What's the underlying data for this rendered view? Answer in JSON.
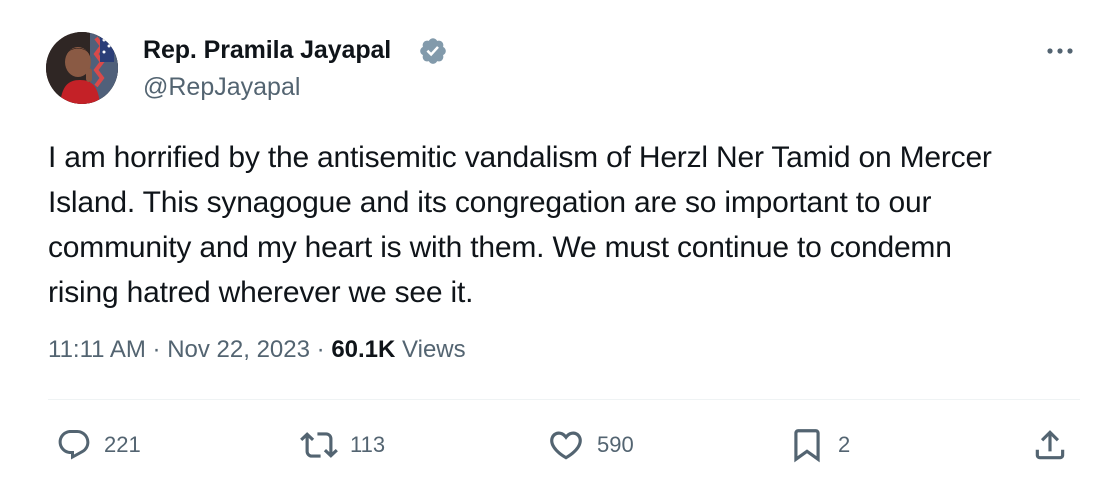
{
  "author": {
    "name": "Rep. Pramila Jayapal",
    "handle": "@RepJayapal",
    "verified": true
  },
  "tweet": {
    "text_lines": [
      "I am horrified by the antisemitic vandalism of Herzl Ner Tamid on Mercer",
      "Island. This synagogue and its congregation are so important to our",
      "community and my heart is with them. We must continue to condemn",
      "rising hatred wherever we see it."
    ],
    "time": "11:11 AM",
    "date": "Nov 22, 2023",
    "separator": "·",
    "views_count": "60.1K",
    "views_label": "Views"
  },
  "actions": {
    "replies": "221",
    "reposts": "113",
    "likes": "590",
    "bookmarks": "2"
  },
  "colors": {
    "text_primary": "#0f1419",
    "text_secondary": "#536471",
    "verified_badge": "#829aab",
    "divider": "#eff3f4"
  },
  "icons": [
    "more-icon",
    "verified-icon",
    "reply-icon",
    "repost-icon",
    "like-icon",
    "bookmark-icon",
    "share-icon"
  ]
}
